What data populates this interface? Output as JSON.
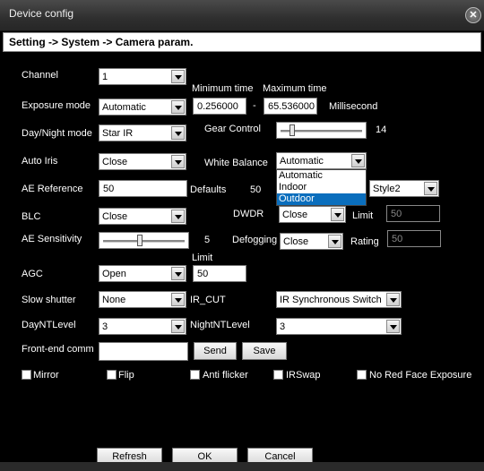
{
  "window": {
    "title": "Device config",
    "breadcrumb": "Setting -> System -> Camera param."
  },
  "labels": {
    "channel": "Channel",
    "exposure_mode": "Exposure mode",
    "minimum_time": "Minimum time",
    "maximum_time": "Maximum time",
    "dash": "-",
    "millisecond": "Millisecond",
    "day_night_mode": "Day/Night mode",
    "gear_control": "Gear Control",
    "auto_iris": "Auto Iris",
    "white_balance": "White Balance",
    "ae_reference": "AE Reference",
    "defaults": "Defaults",
    "blc": "BLC",
    "dwdr": "DWDR",
    "limit": "Limit",
    "ae_sensitivity": "AE Sensitivity",
    "defogging": "Defogging",
    "rating": "Rating",
    "agc": "AGC",
    "agc_limit": "Limit",
    "slow_shutter": "Slow shutter",
    "ir_cut": "IR_CUT",
    "day_nt_level": "DayNTLevel",
    "night_nt_level": "NightNTLevel",
    "front_end_comm": "Front-end comm"
  },
  "values": {
    "channel": "1",
    "exposure_mode": "Automatic",
    "min_time": "0.256000",
    "max_time": "65.536000",
    "day_night_mode": "Star IR",
    "gear_control": "14",
    "gear_control_level": 0.12,
    "auto_iris": "Close",
    "white_balance": "Automatic",
    "white_balance_options": [
      "Automatic",
      "Indoor",
      "Outdoor"
    ],
    "white_balance_highlighted": "Outdoor",
    "ae_reference": "50",
    "defaults": "50",
    "style": "Style2",
    "blc": "Close",
    "dwdr": "Close",
    "dwdr_limit": "50",
    "ae_sensitivity": "5",
    "ae_sensitivity_level": 0.45,
    "defogging": "Close",
    "rating": "50",
    "agc": "Open",
    "agc_limit": "50",
    "slow_shutter": "None",
    "ir_cut": "IR Synchronous Switch",
    "day_nt_level": "3",
    "night_nt_level": "3",
    "front_end_comm": ""
  },
  "buttons": {
    "send": "Send",
    "save": "Save",
    "refresh": "Refresh",
    "ok": "OK",
    "cancel": "Cancel"
  },
  "checkboxes": {
    "mirror": "Mirror",
    "flip": "Flip",
    "anti_flicker": "Anti flicker",
    "irswap": "IRSwap",
    "no_red_face": "No Red Face Exposure"
  },
  "colors": {
    "background": "#000000",
    "highlight": "#0a6ebd"
  }
}
